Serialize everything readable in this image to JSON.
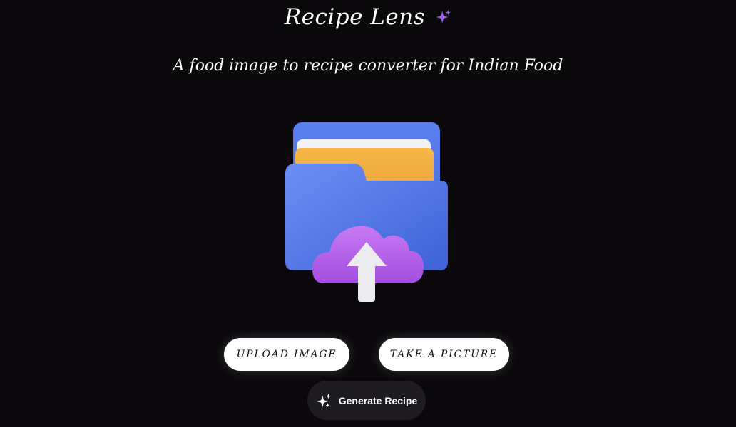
{
  "header": {
    "title": "Recipe Lens",
    "title_icon": "sparkle-icon",
    "subtitle": "A food image to recipe converter for Indian Food"
  },
  "illustration": {
    "icon": "folder-upload-icon"
  },
  "actions": {
    "upload_label": "UPLOAD IMAGE",
    "picture_label": "TAKE A PICTURE",
    "generate_label": "Generate Recipe",
    "generate_icon": "sparkle-icon"
  },
  "colors": {
    "background": "#0b090c",
    "accent_purple": "#9b5cf0",
    "folder_blue": "#4a6fe3",
    "paper_orange": "#f2a93b",
    "cloud_purple": "#b25ee8",
    "generate_button_bg": "#1e1c20"
  }
}
